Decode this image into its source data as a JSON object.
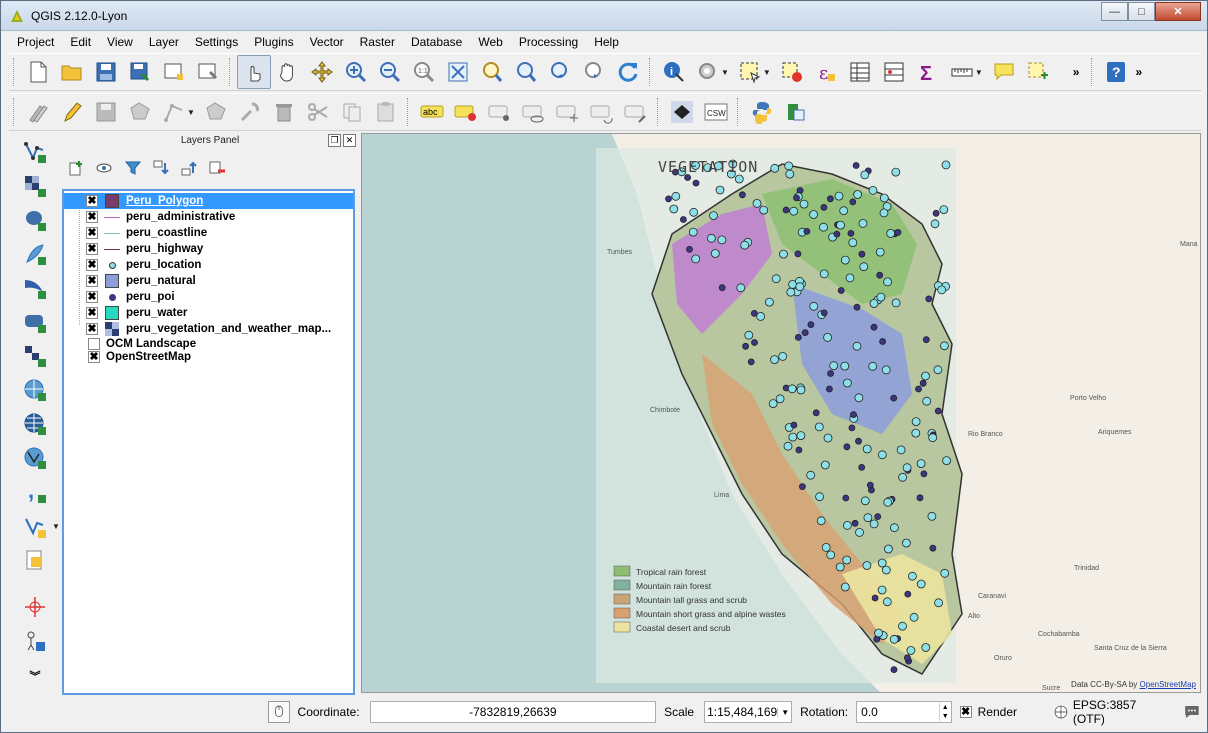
{
  "window": {
    "title": "QGIS 2.12.0-Lyon",
    "minimize": "—",
    "maximize": "□",
    "close": "✕"
  },
  "menu": [
    "Project",
    "Edit",
    "View",
    "Layer",
    "Settings",
    "Plugins",
    "Vector",
    "Raster",
    "Database",
    "Web",
    "Processing",
    "Help"
  ],
  "toolbar": {
    "overflow": "»",
    "csw_label": "CSW",
    "abc_label": "abc"
  },
  "layers_panel": {
    "title": "Layers Panel",
    "float_button": "❐",
    "close_button": "✕",
    "layers": [
      {
        "name": "Peru_Polygon",
        "checked": "✖",
        "symbol_color": "#7a3a6a",
        "symbol": "fill"
      },
      {
        "name": "peru_administrative",
        "checked": "✖",
        "symbol_color": "#c25bd1",
        "symbol": "line"
      },
      {
        "name": "peru_coastline",
        "checked": "✖",
        "symbol_color": "#7fc7b0",
        "symbol": "line"
      },
      {
        "name": "peru_highway",
        "checked": "✖",
        "symbol_color": "#7a3050",
        "symbol": "line"
      },
      {
        "name": "peru_location",
        "checked": "✖",
        "symbol_color": "#8ee0e8",
        "symbol": "point"
      },
      {
        "name": "peru_natural",
        "checked": "✖",
        "symbol_color": "#8e9ed9",
        "symbol": "fill"
      },
      {
        "name": "peru_poi",
        "checked": "✖",
        "symbol_color": "#3c3580",
        "symbol": "point"
      },
      {
        "name": "peru_water",
        "checked": "✖",
        "symbol_color": "#27d9c2",
        "symbol": "fill"
      },
      {
        "name": "peru_vegetation_and_weather_map...",
        "checked": "✖",
        "symbol_color": "#3a4d8a",
        "symbol": "raster"
      },
      {
        "name": "OCM Landscape",
        "checked": "",
        "symbol_color": "",
        "symbol": "none"
      },
      {
        "name": "OpenStreetMap",
        "checked": "✖",
        "symbol_color": "",
        "symbol": "none"
      }
    ]
  },
  "map": {
    "overlay_title": "VEGETATION",
    "legend": [
      {
        "label": "Tropical rain forest",
        "color": "#8cbf72"
      },
      {
        "label": "Mountain rain forest",
        "color": "#7fb29a"
      },
      {
        "label": "Mountain tall grass and scrub",
        "color": "#c9a477"
      },
      {
        "label": "Mountain short grass and alpine wastes",
        "color": "#d9a070"
      },
      {
        "label": "Coastal desert and scrub",
        "color": "#ece3a0"
      }
    ],
    "place_labels": [
      {
        "text": "Tumbes"
      },
      {
        "text": "Chimbote"
      },
      {
        "text": "Lima"
      },
      {
        "text": "Porto Velho"
      },
      {
        "text": "Rio Branco"
      },
      {
        "text": "Ariquemes"
      },
      {
        "text": "Trinidad"
      },
      {
        "text": "Caranavi"
      },
      {
        "text": "Oruro"
      },
      {
        "text": "Cochabamba"
      },
      {
        "text": "Santa Cruz de la Sierra"
      },
      {
        "text": "Sucre"
      },
      {
        "text": "Alto"
      },
      {
        "text": "Mana"
      }
    ],
    "attribution_prefix": "Data CC-By-SA by ",
    "attribution_link": "OpenStreetMap"
  },
  "statusbar": {
    "coordinate_label": "Coordinate:",
    "coordinate_value": "-7832819,26639",
    "scale_label": "Scale",
    "scale_value": "1:15,484,169",
    "rotation_label": "Rotation:",
    "rotation_value": "0.0",
    "render_label": "Render",
    "render_checked": "✖",
    "crs_label": "EPSG:3857 (OTF)"
  }
}
